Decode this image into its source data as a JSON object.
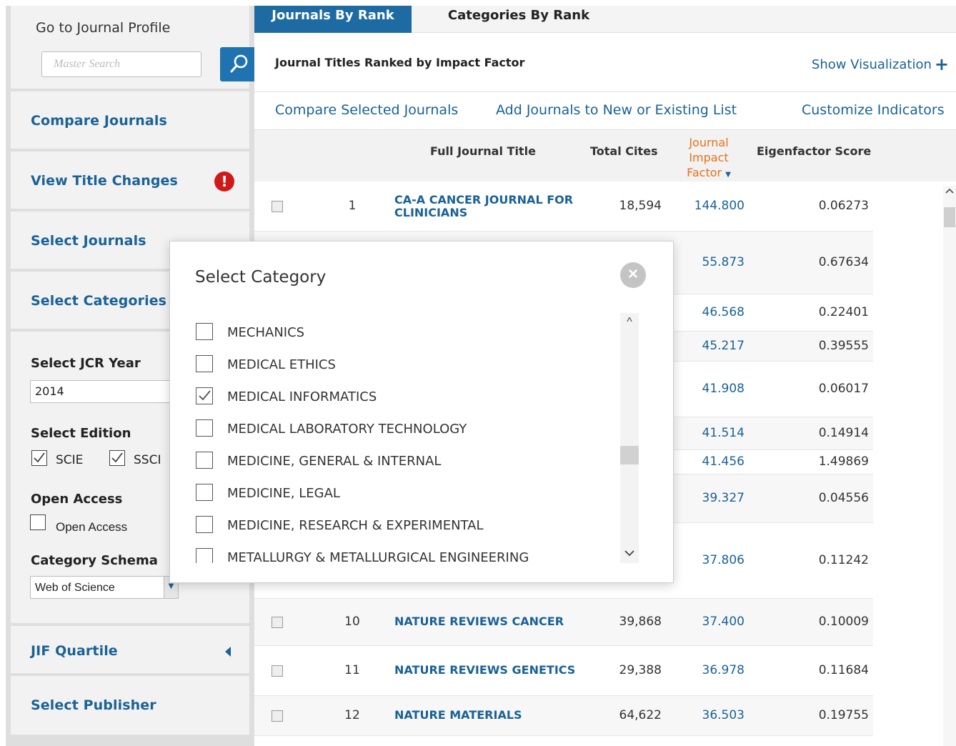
{
  "sidebar": {
    "goto_title": "Go to Journal Profile",
    "search_placeholder": "Master Search",
    "compare_journals": "Compare Journals",
    "view_title_changes": "View Title Changes",
    "select_journals": "Select Journals",
    "select_categories": "Select Categories",
    "select_jcr_year": "Select JCR Year",
    "jcr_year_value": "2014",
    "select_edition": "Select Edition",
    "edition_scie": "SCIE",
    "edition_ssci": "SSCI",
    "open_access_heading": "Open Access",
    "open_access_label": "Open Access",
    "category_schema": "Category Schema",
    "schema_value": "Web of Science",
    "jif_quartile": "JIF Quartile",
    "select_publisher": "Select Publisher"
  },
  "tabs": {
    "journals_by_rank": "Journals By Rank",
    "categories_by_rank": "Categories By Rank"
  },
  "header": {
    "ranked_title": "Journal Titles Ranked by Impact Factor",
    "show_visualization": "Show Visualization"
  },
  "actions": {
    "compare_selected": "Compare Selected Journals",
    "add_to_list": "Add Journals to New or Existing List",
    "customize": "Customize Indicators"
  },
  "columns": {
    "full_title": "Full Journal Title",
    "total_cites": "Total Cites",
    "jif_line1": "Journal",
    "jif_line2": "Impact",
    "jif_line3": "Factor",
    "eigenfactor": "Eigenfactor Score"
  },
  "rows": [
    {
      "rank": "1",
      "title": "CA-A CANCER JOURNAL FOR CLINICIANS",
      "cites": "18,594",
      "jif": "144.800",
      "eig": "0.06273"
    },
    {
      "rank": "",
      "title": "",
      "cites": "",
      "jif": "55.873",
      "eig": "0.67634"
    },
    {
      "rank": "",
      "title": "",
      "cites": "",
      "jif": "46.568",
      "eig": "0.22401"
    },
    {
      "rank": "",
      "title": "",
      "cites": "",
      "jif": "45.217",
      "eig": "0.39555"
    },
    {
      "rank": "",
      "title": "",
      "cites": "",
      "jif": "41.908",
      "eig": "0.06017"
    },
    {
      "rank": "",
      "title": "",
      "cites": "",
      "jif": "41.514",
      "eig": "0.14914"
    },
    {
      "rank": "",
      "title": "",
      "cites": "",
      "jif": "41.456",
      "eig": "1.49869"
    },
    {
      "rank": "",
      "title": "",
      "cites": "",
      "jif": "39.327",
      "eig": "0.04556"
    },
    {
      "rank": "",
      "title": "",
      "cites": "",
      "jif": "37.806",
      "eig": "0.11242"
    },
    {
      "rank": "10",
      "title": "NATURE REVIEWS CANCER",
      "cites": "39,868",
      "jif": "37.400",
      "eig": "0.10009"
    },
    {
      "rank": "11",
      "title": "NATURE REVIEWS GENETICS",
      "cites": "29,388",
      "jif": "36.978",
      "eig": "0.11684"
    },
    {
      "rank": "12",
      "title": "NATURE MATERIALS",
      "cites": "64,622",
      "jif": "36.503",
      "eig": "0.19755"
    }
  ],
  "modal": {
    "title": "Select Category",
    "categories": [
      {
        "label": "MECHANICS",
        "checked": false
      },
      {
        "label": "MEDICAL ETHICS",
        "checked": false
      },
      {
        "label": "MEDICAL INFORMATICS",
        "checked": true
      },
      {
        "label": "MEDICAL LABORATORY TECHNOLOGY",
        "checked": false
      },
      {
        "label": "MEDICINE, GENERAL & INTERNAL",
        "checked": false
      },
      {
        "label": "MEDICINE, LEGAL",
        "checked": false
      },
      {
        "label": "MEDICINE, RESEARCH & EXPERIMENTAL",
        "checked": false
      },
      {
        "label": "METALLURGY & METALLURGICAL ENGINEERING",
        "checked": false
      }
    ]
  },
  "colors": {
    "accent": "#1e6aa3",
    "link": "#1a6296",
    "jif_header": "#e8701a",
    "alert": "#d01a1a"
  }
}
